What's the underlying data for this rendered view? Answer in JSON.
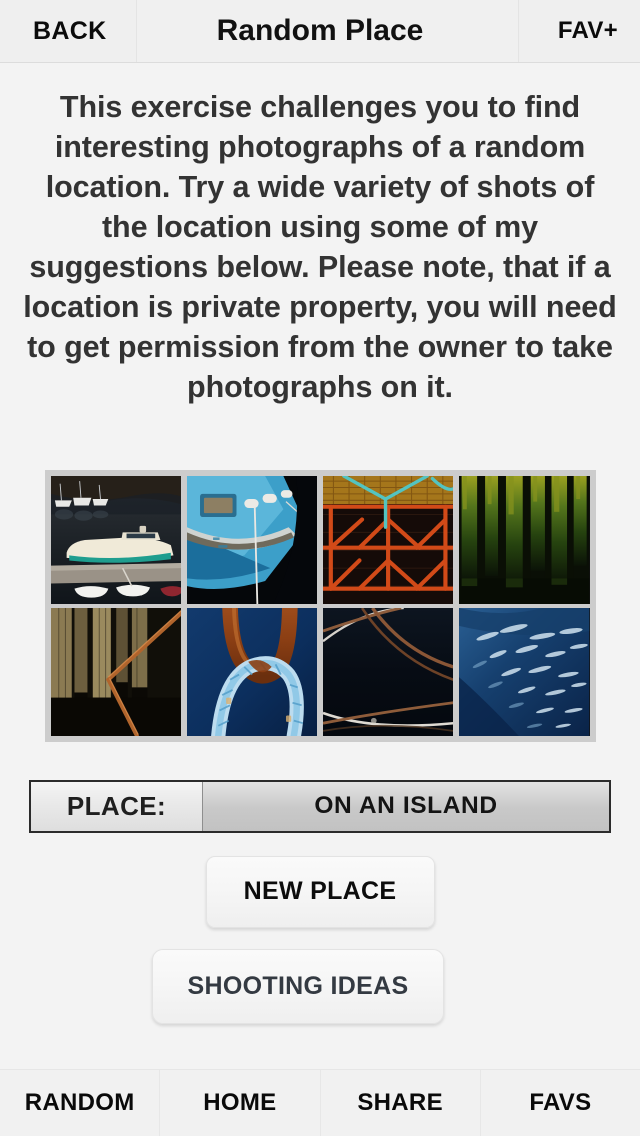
{
  "navbar": {
    "back_label": "BACK",
    "title": "Random Place",
    "fav_label": "FAV+"
  },
  "main": {
    "description": "This exercise challenges you to find interesting photographs of a random location. Try a wide variety of shots of the location using some of my suggestions below. Please note, that if a location is private property, you will need to get permission from the owner to take photographs on it.",
    "gallery": {
      "panel_background": "#cccccc",
      "columns": 4,
      "rows": 2,
      "thumbnails": [
        {
          "name": "harbour-boats-at-dock",
          "alt": "White motorboat moored at a pier with small dinghies and dark water"
        },
        {
          "name": "blue-boat-bow",
          "alt": "Bow of a bright blue fishing boat with porthole window"
        },
        {
          "name": "red-lobster-traps",
          "alt": "Stacked red and orange lobster traps with teal rope"
        },
        {
          "name": "green-mossy-pilings",
          "alt": "Green algae covered wooden harbour pilings"
        },
        {
          "name": "weathered-pilings-and-chain",
          "alt": "Rusted chain against weathered wooden pilings"
        },
        {
          "name": "rusty-ring-with-blue-rope",
          "alt": "Rusty mooring ring threaded with blue and white rope"
        },
        {
          "name": "crossing-ropes-dark-water",
          "alt": "Mooring lines crossing over dark water"
        },
        {
          "name": "rippled-blue-water",
          "alt": "Sunlit ripples on deep blue water"
        }
      ]
    },
    "place_selector": {
      "label": "PLACE:",
      "value": "ON AN ISLAND"
    },
    "buttons": {
      "new_place": "NEW PLACE",
      "shooting_ideas": "SHOOTING IDEAS"
    }
  },
  "tabbar": {
    "tabs": [
      {
        "label": "RANDOM",
        "name": "tab-random"
      },
      {
        "label": "HOME",
        "name": "tab-home"
      },
      {
        "label": "SHARE",
        "name": "tab-share"
      },
      {
        "label": "FAVS",
        "name": "tab-favs"
      }
    ]
  },
  "colors": {
    "page_background": "#f2f2f2",
    "navbar_background": "#f0f0f0",
    "text_primary": "#111111",
    "description_text": "#333333",
    "gallery_panel": "#cccccc",
    "place_border": "#2b2b2b"
  }
}
